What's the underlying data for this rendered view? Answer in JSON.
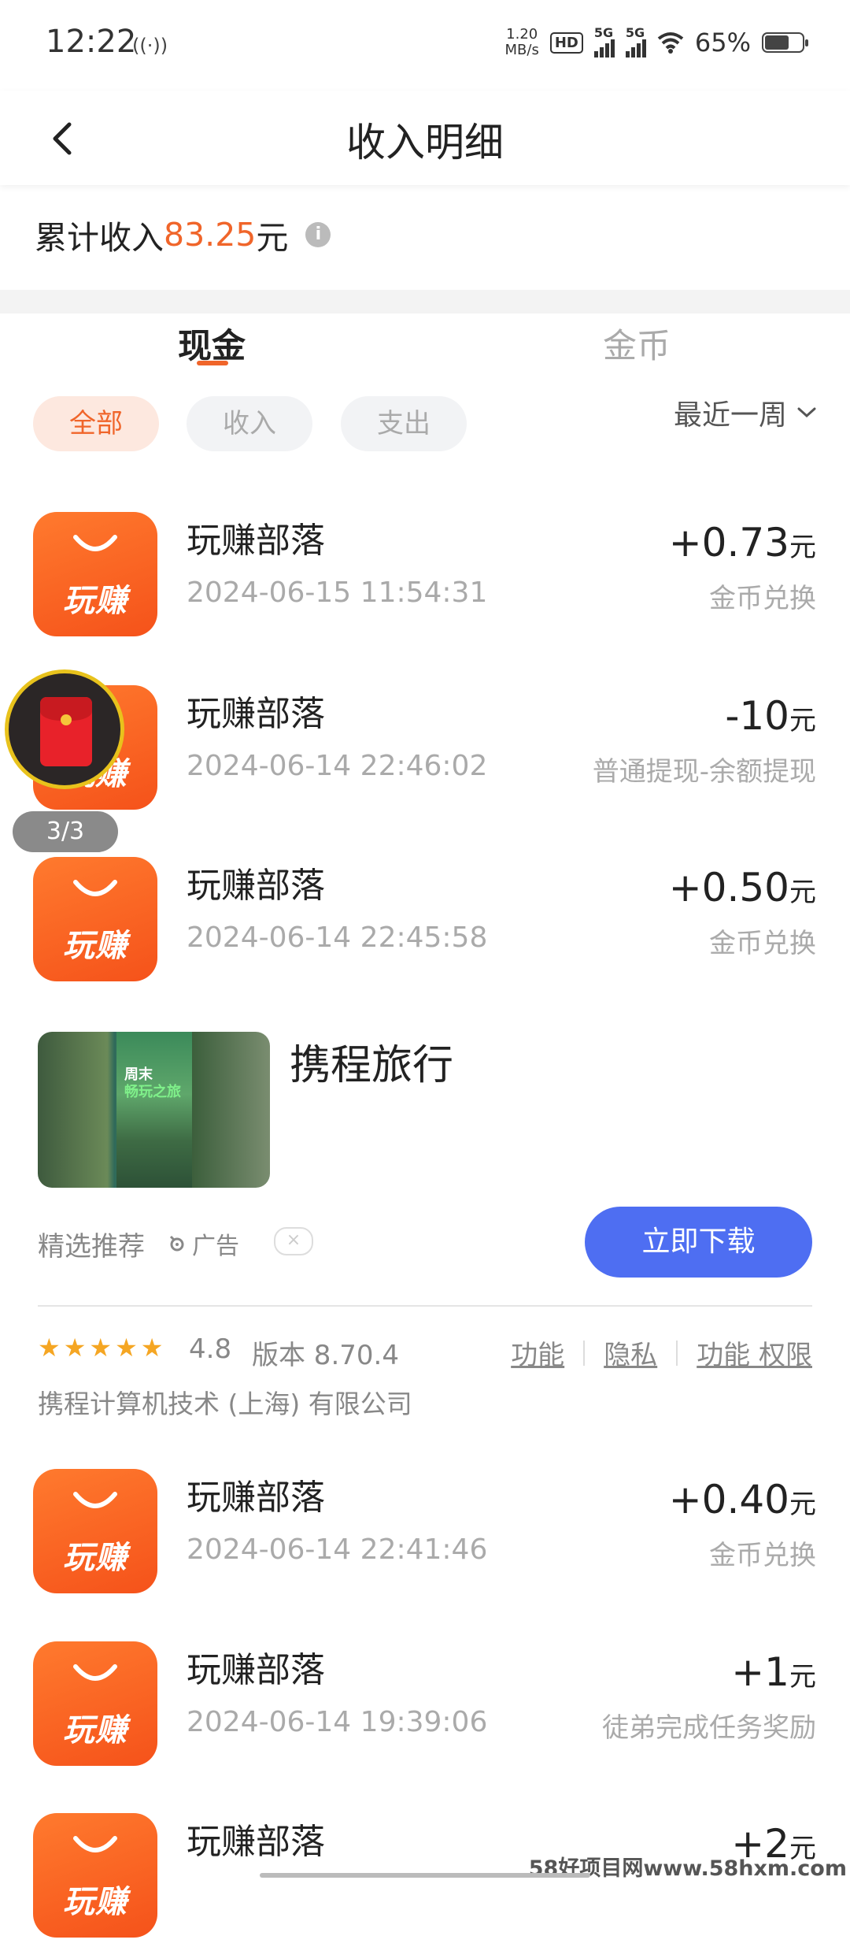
{
  "status_bar": {
    "time": "12:22",
    "net_speed_value": "1.20",
    "net_speed_unit": "MB/s",
    "hd": "HD",
    "sim1": "5G",
    "sim2": "5G",
    "battery_text": "65%",
    "battery_level": 0.65
  },
  "header": {
    "title": "收入明细"
  },
  "summary": {
    "prefix": "累计收入",
    "amount": "83.25",
    "unit": "元",
    "info_icon": "i"
  },
  "tabs": [
    {
      "label": "现金",
      "active": true
    },
    {
      "label": "金币",
      "active": false
    }
  ],
  "filters": {
    "chips": [
      {
        "label": "全部",
        "active": true
      },
      {
        "label": "收入",
        "active": false
      },
      {
        "label": "支出",
        "active": false
      }
    ],
    "period": "最近一周"
  },
  "app_icon_text": "玩赚",
  "transactions": [
    {
      "title": "玩赚部落",
      "time": "2024-06-15 11:54:31",
      "amount": "+0.73",
      "unit": "元",
      "desc": "金币兑换"
    },
    {
      "title": "玩赚部落",
      "time": "2024-06-14 22:46:02",
      "amount": "-10",
      "unit": "元",
      "desc": "普通提现-余额提现"
    },
    {
      "title": "玩赚部落",
      "time": "2024-06-14 22:45:58",
      "amount": "+0.50",
      "unit": "元",
      "desc": "金币兑换"
    },
    {
      "title": "玩赚部落",
      "time": "2024-06-14 22:41:46",
      "amount": "+0.40",
      "unit": "元",
      "desc": "金币兑换"
    },
    {
      "title": "玩赚部落",
      "time": "2024-06-14 19:39:06",
      "amount": "+1",
      "unit": "元",
      "desc": "徒弟完成任务奖励"
    },
    {
      "title": "玩赚部落",
      "time": "",
      "amount": "+2",
      "unit": "元",
      "desc": ""
    }
  ],
  "floating": {
    "badge": "3/3"
  },
  "ad": {
    "name": "携程旅行",
    "image_text_1": "周末",
    "image_text_2": "畅玩之旅",
    "recommend": "精选推荐",
    "ad_label": "广告",
    "close": "×",
    "download": "立即下载",
    "rating": 4.8,
    "rating_text": "4.8",
    "version": "版本 8.70.4",
    "links": [
      "功能",
      "隐私",
      "功能 权限"
    ],
    "company": "携程计算机技术 (上海) 有限公司"
  },
  "watermark": "58好项目网www.58hxm.com"
}
